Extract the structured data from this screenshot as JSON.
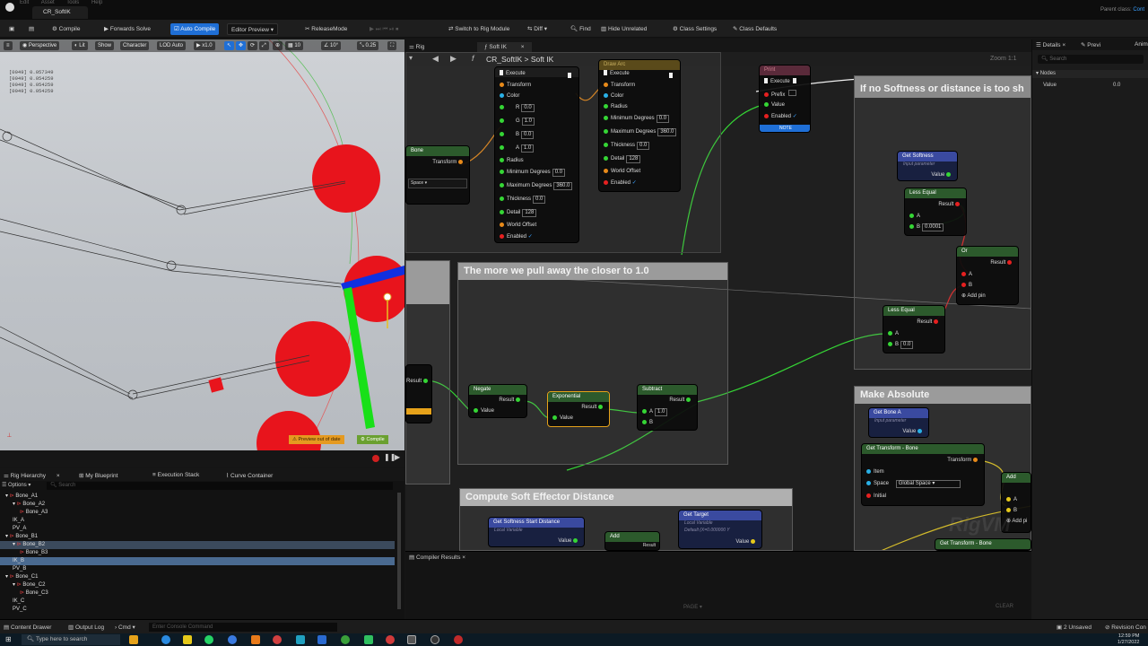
{
  "window": {
    "tab": "CR_SoftIK",
    "parent_class_label": "Parent class:",
    "parent_class_value": "Cont"
  },
  "menus": [
    "Edit",
    "Asset",
    "Tools",
    "Help"
  ],
  "toolbar": {
    "compile": "Compile",
    "forwards_solve": "Forwards Solve",
    "auto_compile": "Auto Compile",
    "editor_preview": "Editor Preview",
    "release_mode": "ReleaseMode",
    "switch_rig": "Switch to Rig Module",
    "diff": "Diff",
    "find": "Find",
    "hide_unrelated": "Hide Unrelated",
    "class_settings": "Class Settings",
    "class_defaults": "Class Defaults"
  },
  "viewport": {
    "perspective": "Perspective",
    "lit": "Lit",
    "show": "Show",
    "character": "Character",
    "lod": "LOD Auto",
    "speed": "x1.0",
    "grid": "10",
    "angle": "10°",
    "scale": "0.25",
    "coords": [
      "[0049] 0.057349",
      "[0049] 0.054259",
      "[0049] 0.054259",
      "[0049] 0.054259"
    ],
    "preview_badge": "Preview out of date",
    "compile_badge": "Compile"
  },
  "graph": {
    "tab_rig": "Rig",
    "tab_softik": "Soft IK",
    "breadcrumb_fn": "f",
    "breadcrumb": "CR_SoftIK > Soft IK",
    "zoom": "Zoom 1:1",
    "watermark": "RigVM"
  },
  "comments": {
    "softness_check": "If no Softness or distance is too sh",
    "pull_away": "The more we pull away the closer to 1.0",
    "make_absolute": "Make Absolute",
    "soft_effector": "Compute Soft Effector Distance"
  },
  "nodes": {
    "draw_color": {
      "execute": "Execute",
      "transform": "Transform",
      "color": "Color",
      "r": "R",
      "r_val": "0.0",
      "g": "G",
      "g_val": "1.0",
      "b": "B",
      "b_val": "0.0",
      "a": "A",
      "a_val": "1.0",
      "radius": "Radius",
      "min_deg": "Minimum Degrees",
      "min_deg_val": "0.0",
      "max_deg": "Maximum Degrees",
      "max_deg_val": "360.0",
      "thickness": "Thickness",
      "thickness_val": "0.0",
      "detail": "Detail",
      "detail_val": "128",
      "world_offset": "World Offset",
      "enabled": "Enabled"
    },
    "draw_arc": {
      "title": "Draw Arc",
      "execute": "Execute",
      "transform": "Transform",
      "color": "Color",
      "radius": "Radius",
      "min_deg": "Minimum Degrees",
      "min_deg_val": "0.0",
      "max_deg": "Maximum Degrees",
      "max_deg_val": "360.0",
      "thickness": "Thickness",
      "thickness_val": "0.0",
      "detail": "Detail",
      "detail_val": "128",
      "world_offset": "World Offset",
      "enabled": "Enabled"
    },
    "print": {
      "title": "Print",
      "execute": "Execute",
      "prefix": "Prefix",
      "value": "Value",
      "enabled": "Enabled",
      "footer": "NOTE"
    },
    "bone_left": {
      "title": "Bone",
      "transform": "Transform",
      "space": "Space"
    },
    "get_softness": {
      "title": "Get Softness",
      "sub": "Input parameter",
      "value": "Value"
    },
    "less_equal_1": {
      "title": "Less Equal",
      "result": "Result",
      "a": "A",
      "b": "B",
      "b_val": "0.0001"
    },
    "or_node": {
      "title": "Or",
      "result": "Result",
      "a": "A",
      "b": "B",
      "add_pin": "Add pin"
    },
    "less_equal_2": {
      "title": "Less Equal",
      "result": "Result",
      "a": "A",
      "b": "B",
      "b_val": "0.0"
    },
    "result_left": {
      "title": "Result"
    },
    "negate": {
      "title": "Negate",
      "result": "Result",
      "value": "Value"
    },
    "exponential": {
      "title": "Exponential",
      "result": "Result",
      "value": "Value"
    },
    "subtract": {
      "title": "Subtract",
      "result": "Result",
      "a": "A",
      "a_val": "1.0",
      "b": "B"
    },
    "get_bone_a": {
      "title": "Get Bone A",
      "sub": "Input parameter",
      "value": "Value"
    },
    "get_transform_bone": {
      "title": "Get Transform - Bone",
      "transform": "Transform",
      "item": "Item",
      "space": "Space",
      "space_val": "Global Space",
      "initial": "Initial"
    },
    "get_transform_bone_2": {
      "title": "Get Transform - Bone"
    },
    "add_right": {
      "title": "Add",
      "a": "A",
      "b": "B",
      "add_pin": "Add pi"
    },
    "get_soft_start": {
      "title": "Get Softness Start Distance",
      "sub": "Local Variable",
      "value": "Value"
    },
    "add_mid": {
      "title": "Add",
      "result": "Result"
    },
    "get_target": {
      "title": "Get Target",
      "sub": "Local Variable",
      "sub2": "Default (X=0.000000 Y",
      "value": "Value"
    }
  },
  "details": {
    "tab_details": "Details",
    "tab_preview": "Previ",
    "tab_anim": "Anim",
    "search_placeholder": "Search",
    "section": "Nodes",
    "value_label": "Value",
    "value": "0.0"
  },
  "compiler": {
    "tab": "Compiler Results",
    "page": "PAGE",
    "clear": "CLEAR"
  },
  "hierarchy": {
    "tabs": [
      "Rig Hierarchy",
      "My Blueprint",
      "Execution Stack",
      "Curve Container"
    ],
    "options": "Options",
    "search_placeholder": "Search",
    "items": [
      "Bone_A1",
      "Bone_A2",
      "Bone_A3",
      "IK_A",
      "PV_A",
      "Bone_B1",
      "Bone_B2",
      "Bone_B3",
      "IK_B",
      "PV_B",
      "Bone_C1",
      "Bone_C2",
      "Bone_C3",
      "IK_C",
      "PV_C"
    ]
  },
  "status": {
    "content_drawer": "Content Drawer",
    "output_log": "Output Log",
    "cmd": "Cmd",
    "console_placeholder": "Enter Console Command",
    "unsaved": "2 Unsaved",
    "revision": "Revision Con"
  },
  "taskbar": {
    "search_placeholder": "Type here to search",
    "time": "12:59 PM",
    "date": "1/27/2022"
  },
  "colors": {
    "accent": "#1f6fd6",
    "exec_pin": "#f0f0f0",
    "float_pin": "#35d635",
    "transform_pin": "#e88a1a",
    "bool_pin": "#e62020",
    "selected": "#e6a21a"
  }
}
